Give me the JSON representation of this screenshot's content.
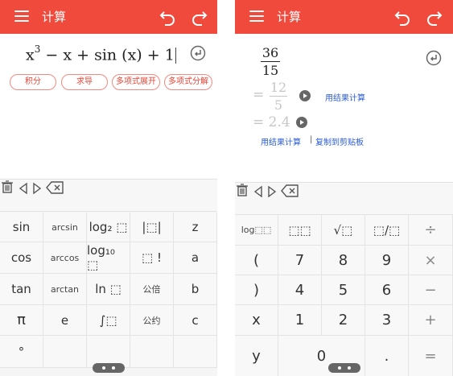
{
  "title": "计算",
  "left": {
    "expression": {
      "pre": "x",
      "exp": "3",
      "post": " − x + sin (x) + 1"
    },
    "chips": [
      "积分",
      "求导",
      "多项式展开",
      "多项式分解"
    ],
    "keys": [
      [
        "sin",
        "arcsin",
        "log₂ ⬚",
        "|⬚|",
        "z"
      ],
      [
        "cos",
        "arccos",
        "log₁₀ ⬚",
        "⬚ !",
        "a"
      ],
      [
        "tan",
        "arctan",
        "ln ⬚",
        "公倍",
        "b"
      ],
      [
        "π",
        "e",
        "∫⬚",
        "公约",
        "c"
      ],
      [
        "°",
        "",
        "",
        "",
        ""
      ]
    ]
  },
  "right": {
    "result": {
      "num": "36",
      "den": "15"
    },
    "alt1": {
      "prefix": "=",
      "num": "12",
      "den": "5"
    },
    "alt2": "= 2.4",
    "use_result": "用结果计算",
    "copy": "复制到剪贴板",
    "separator": "|",
    "keys": [
      [
        "log⬚⬚",
        "⬚⬚",
        "√⬚",
        "⬚/⬚",
        "÷"
      ],
      [
        "(",
        "7",
        "8",
        "9",
        "×"
      ],
      [
        ")",
        "4",
        "5",
        "6",
        "−"
      ],
      [
        "x",
        "1",
        "2",
        "3",
        "+"
      ],
      [
        "y",
        "0",
        "",
        ".",
        "="
      ]
    ]
  },
  "colors": {
    "accent": "#ef4a3c",
    "link": "#2a5bd7"
  }
}
